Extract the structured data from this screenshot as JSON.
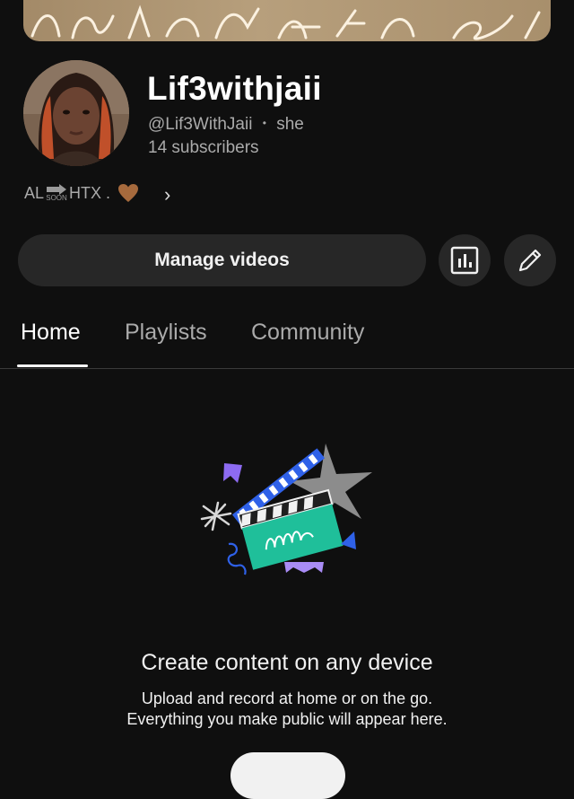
{
  "banner": {
    "alt_art": "handwritten-neon-text"
  },
  "channel": {
    "name": "Lif3withjaii",
    "handle": "@Lif3WithJaii",
    "separator": "•",
    "pronouns": "she",
    "subscribers": "14 subscribers"
  },
  "bio": {
    "from": "AL",
    "soon": "SOON",
    "to": "HTX .",
    "heart_icon": "brown-heart-icon",
    "chevron": "›"
  },
  "actions": {
    "manage_videos": "Manage videos",
    "analytics_icon": "analytics-icon",
    "edit_icon": "pencil-icon"
  },
  "tabs": [
    {
      "label": "Home",
      "active": true
    },
    {
      "label": "Playlists",
      "active": false
    },
    {
      "label": "Community",
      "active": false
    }
  ],
  "empty_state": {
    "title": "Create content on any device",
    "line1": "Upload and record at home or on the go.",
    "line2": "Everything you make public will appear here."
  },
  "colors": {
    "background": "#0f0f0f",
    "button_bg": "#272727",
    "text_primary": "#f1f1f1",
    "text_secondary": "#aaaaaa"
  }
}
